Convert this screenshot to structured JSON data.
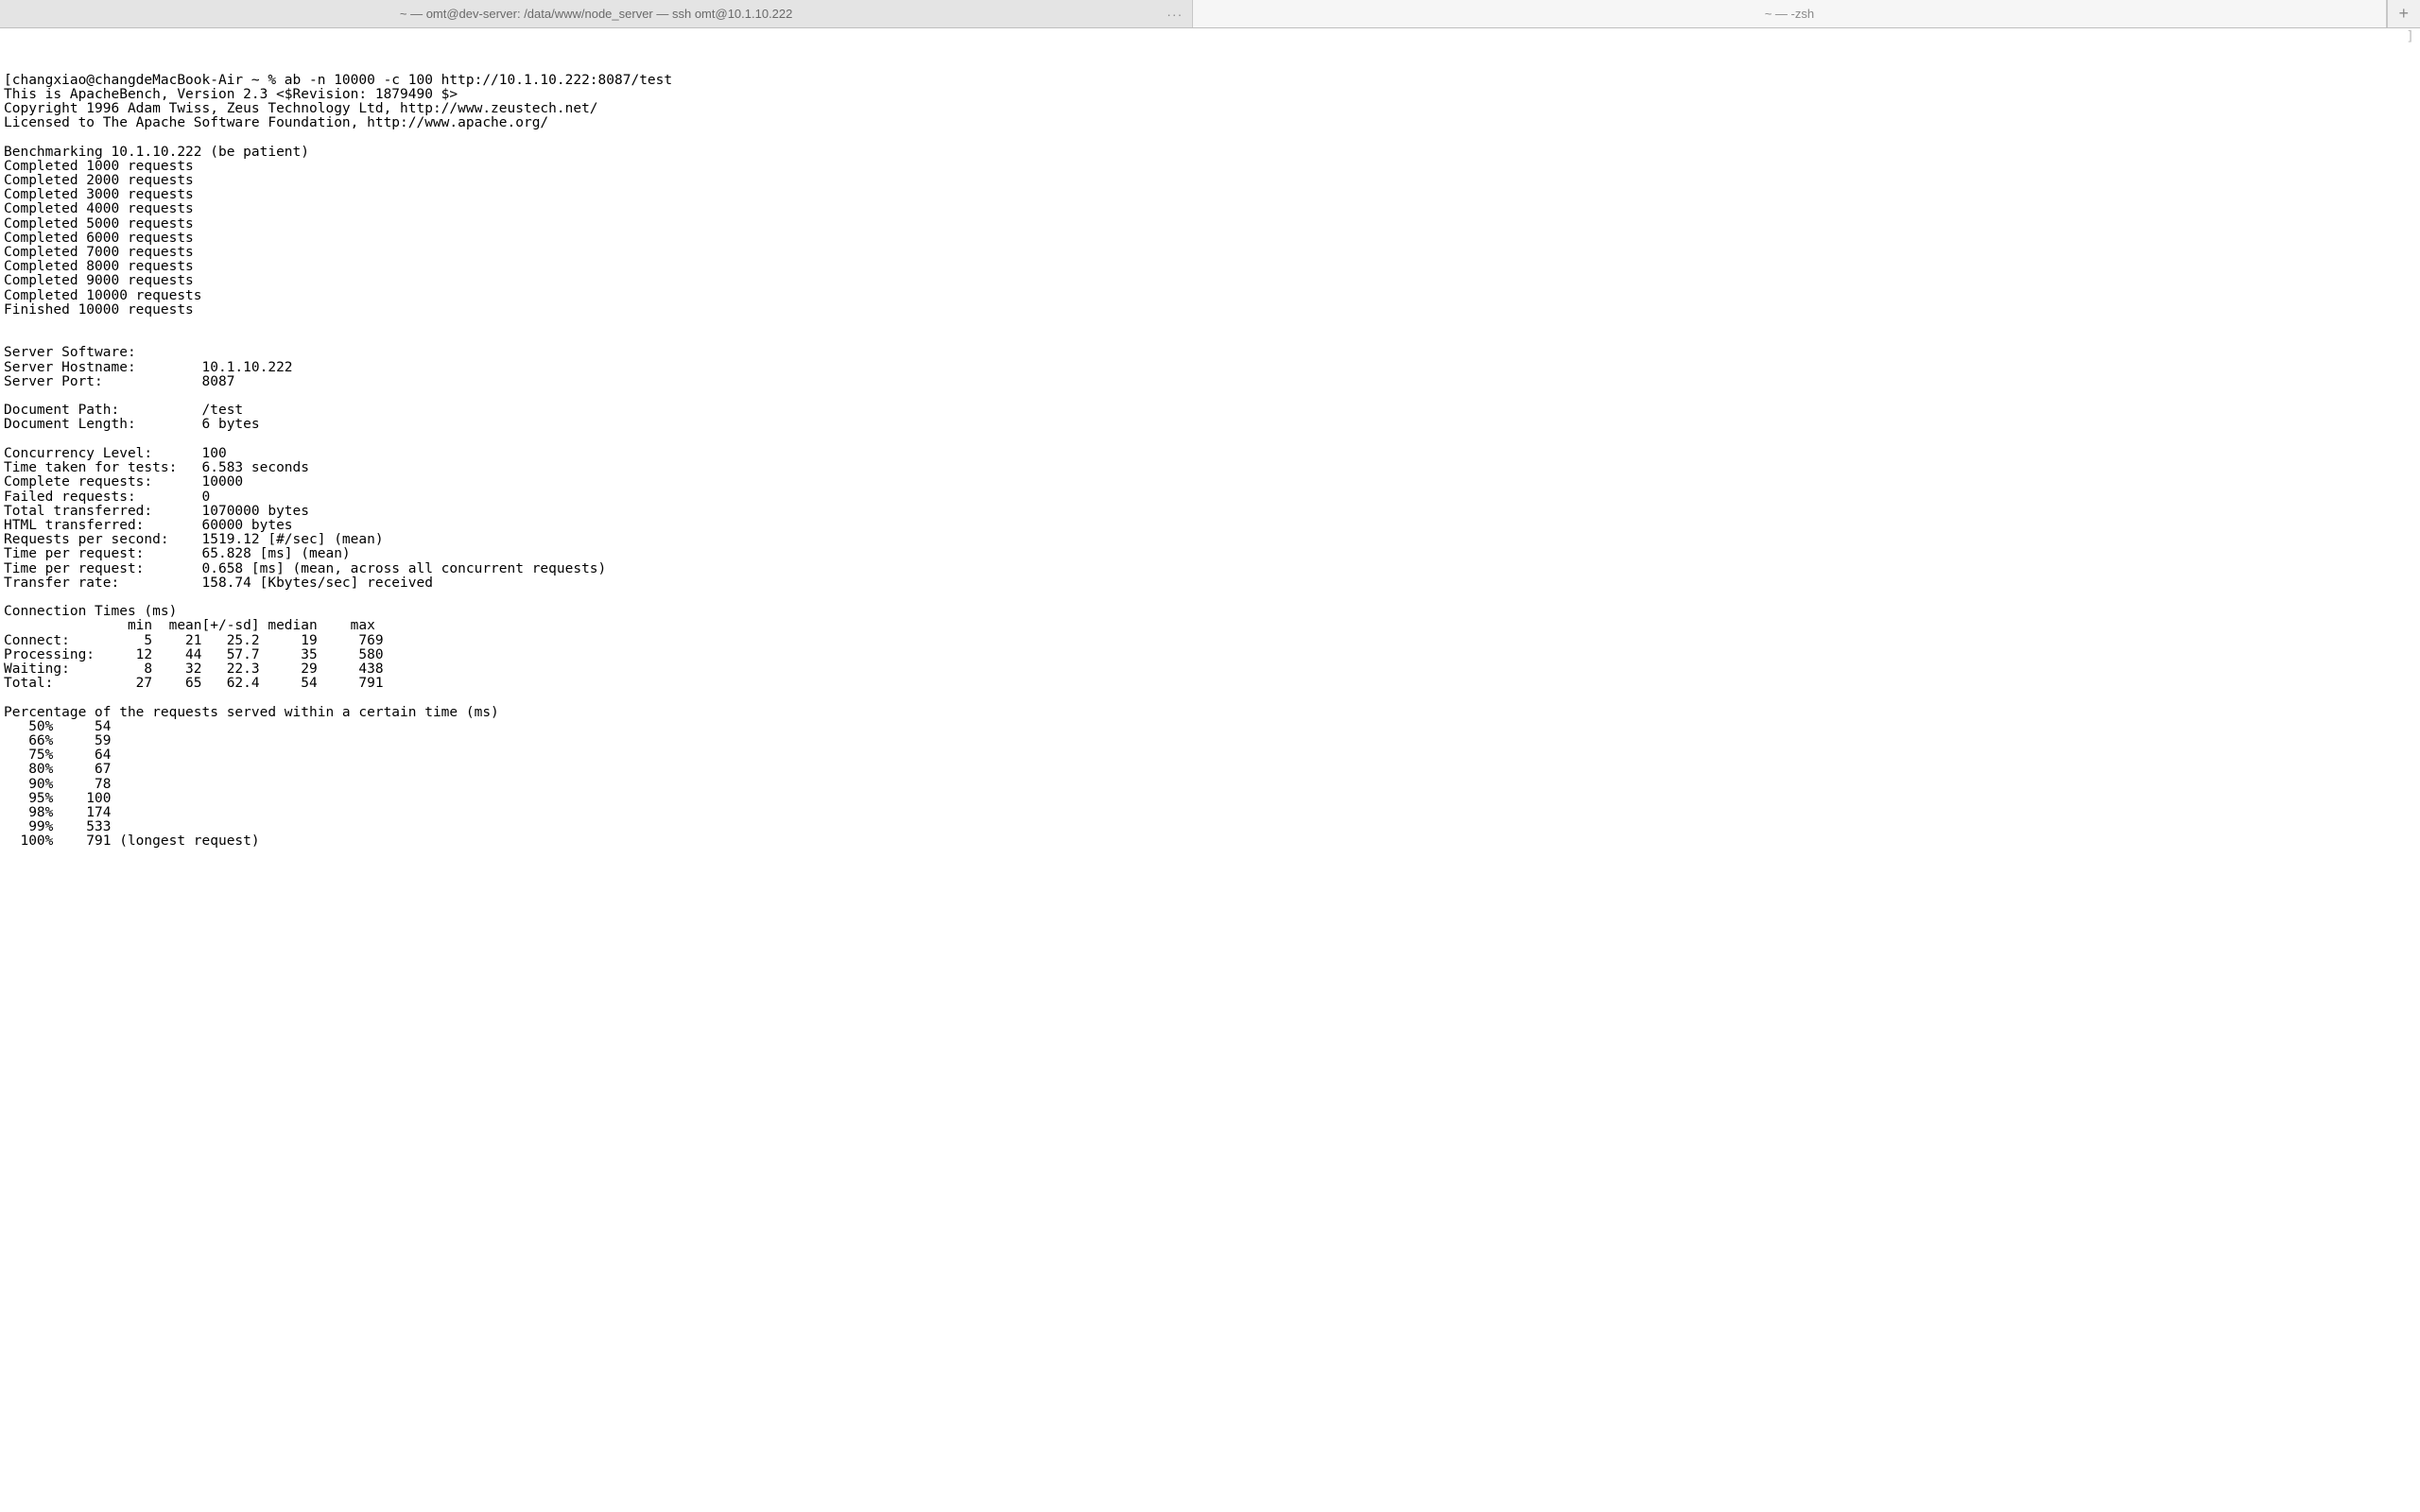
{
  "tabs": {
    "active_title": "~ — omt@dev-server: /data/www/node_server — ssh omt@10.1.10.222",
    "inactive_title": "~ — -zsh",
    "ellipsis": "···",
    "new_tab_glyph": "+"
  },
  "right_bracket": "]",
  "prompt": {
    "user_host": "changxiao@changdeMacBook-Air",
    "path": "~",
    "symbol": "%",
    "command": "ab -n 10000 -c 100 http://10.1.10.222:8087/test"
  },
  "header_lines": [
    "This is ApacheBench, Version 2.3 <$Revision: 1879490 $>",
    "Copyright 1996 Adam Twiss, Zeus Technology Ltd, http://www.zeustech.net/",
    "Licensed to The Apache Software Foundation, http://www.apache.org/"
  ],
  "benchmarking_line": "Benchmarking 10.1.10.222 (be patient)",
  "progress_lines": [
    "Completed 1000 requests",
    "Completed 2000 requests",
    "Completed 3000 requests",
    "Completed 4000 requests",
    "Completed 5000 requests",
    "Completed 6000 requests",
    "Completed 7000 requests",
    "Completed 8000 requests",
    "Completed 9000 requests",
    "Completed 10000 requests",
    "Finished 10000 requests"
  ],
  "summary": [
    {
      "label": "Server Software:",
      "value": ""
    },
    {
      "label": "Server Hostname:",
      "value": "10.1.10.222"
    },
    {
      "label": "Server Port:",
      "value": "8087"
    },
    {
      "blank": true
    },
    {
      "label": "Document Path:",
      "value": "/test"
    },
    {
      "label": "Document Length:",
      "value": "6 bytes"
    },
    {
      "blank": true
    },
    {
      "label": "Concurrency Level:",
      "value": "100"
    },
    {
      "label": "Time taken for tests:",
      "value": "6.583 seconds"
    },
    {
      "label": "Complete requests:",
      "value": "10000"
    },
    {
      "label": "Failed requests:",
      "value": "0"
    },
    {
      "label": "Total transferred:",
      "value": "1070000 bytes"
    },
    {
      "label": "HTML transferred:",
      "value": "60000 bytes"
    },
    {
      "label": "Requests per second:",
      "value": "1519.12 [#/sec] (mean)"
    },
    {
      "label": "Time per request:",
      "value": "65.828 [ms] (mean)"
    },
    {
      "label": "Time per request:",
      "value": "0.658 [ms] (mean, across all concurrent requests)"
    },
    {
      "label": "Transfer rate:",
      "value": "158.74 [Kbytes/sec] received"
    }
  ],
  "conn_times": {
    "title": "Connection Times (ms)",
    "header": [
      "",
      "min",
      "mean",
      "[+/-sd]",
      "median",
      "max"
    ],
    "rows": [
      {
        "name": "Connect:",
        "min": 5,
        "mean": 21,
        "sd": "25.2",
        "median": 19,
        "max": 769
      },
      {
        "name": "Processing:",
        "min": 12,
        "mean": 44,
        "sd": "57.7",
        "median": 35,
        "max": 580
      },
      {
        "name": "Waiting:",
        "min": 8,
        "mean": 32,
        "sd": "22.3",
        "median": 29,
        "max": 438
      },
      {
        "name": "Total:",
        "min": 27,
        "mean": 65,
        "sd": "62.4",
        "median": 54,
        "max": 791
      }
    ]
  },
  "percentiles": {
    "title": "Percentage of the requests served within a certain time (ms)",
    "rows": [
      {
        "pct": "50%",
        "val": 54,
        "note": ""
      },
      {
        "pct": "66%",
        "val": 59,
        "note": ""
      },
      {
        "pct": "75%",
        "val": 64,
        "note": ""
      },
      {
        "pct": "80%",
        "val": 67,
        "note": ""
      },
      {
        "pct": "90%",
        "val": 78,
        "note": ""
      },
      {
        "pct": "95%",
        "val": 100,
        "note": ""
      },
      {
        "pct": "98%",
        "val": 174,
        "note": ""
      },
      {
        "pct": "99%",
        "val": 533,
        "note": ""
      },
      {
        "pct": "100%",
        "val": 791,
        "note": " (longest request)"
      }
    ]
  }
}
